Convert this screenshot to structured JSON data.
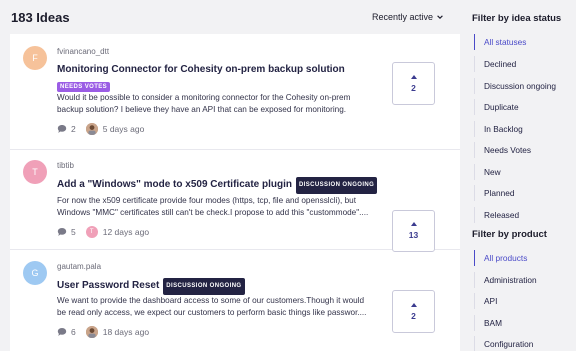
{
  "header": {
    "count_title": "183 Ideas",
    "sort_label": "Recently active"
  },
  "ideas": [
    {
      "avatar_letter": "F",
      "avatar_color": "#f6c29a",
      "author": "fvinancano_dtt",
      "title": "Monitoring Connector for Cohesity on-prem backup solution",
      "badge": "NEEDS VOTES",
      "badge_color": "#9b5de5",
      "description": "Would it be possible to consider a monitoring connector for the Cohesity on-prem backup solution? I believe they have an API that can be exposed for monitoring.",
      "comments": "2",
      "time": "5 days ago",
      "votes": "2"
    },
    {
      "avatar_letter": "T",
      "avatar_color": "#f0a0b8",
      "author": "tibtib",
      "title": "Add a \"Windows\" mode to x509 Certificate plugin",
      "badge": "DISCUSSION ONGOING",
      "badge_color": "#232343",
      "description": "For now the x509 certificate provide four modes (https, tcp, file and opensslcli), but Windows \"MMC\" certificates still can't be check.I propose to add this \"custommode\"....",
      "comments": "5",
      "mini_avatar_letter": "T",
      "time": "12 days ago",
      "votes": "13"
    },
    {
      "avatar_letter": "G",
      "avatar_color": "#9ec9f2",
      "author": "gautam.pala",
      "title": "User Password Reset",
      "badge": "DISCUSSION ONGOING",
      "badge_color": "#232343",
      "description": "We want to provide the dashboard access to some of our customers.Though it would be read only access, we expect our customers to perform basic things like passwor....",
      "comments": "6",
      "time": "18 days ago",
      "votes": "2"
    }
  ],
  "sidebar": {
    "status_heading": "Filter by idea status",
    "statuses": [
      "All statuses",
      "Declined",
      "Discussion ongoing",
      "Duplicate",
      "In Backlog",
      "Needs Votes",
      "New",
      "Planned",
      "Released"
    ],
    "product_heading": "Filter by product",
    "products": [
      "All products",
      "Administration",
      "API",
      "BAM",
      "Configuration"
    ]
  },
  "colors": {
    "accent": "#4a4ac8",
    "vote": "#3b3b8f",
    "background": "#f2f2f4"
  },
  "icons": {
    "sort": "chevron-down-icon",
    "comments": "comment-icon",
    "vote": "upvote-arrow-icon"
  }
}
